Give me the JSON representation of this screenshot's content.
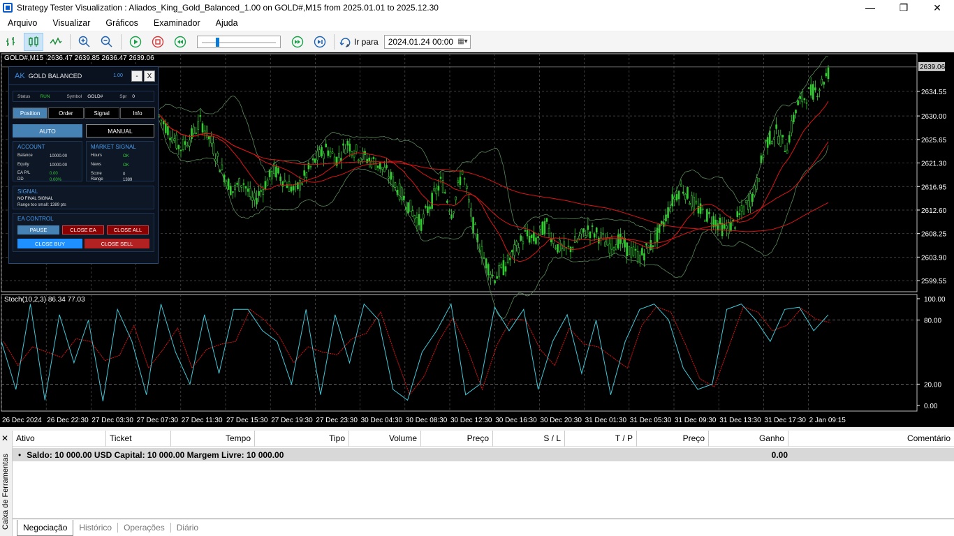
{
  "window": {
    "title": "Strategy Tester Visualization : Aliados_King_Gold_Balanced_1.00 on GOLD#,M15 from 2025.01.01 to 2025.12.30",
    "minimize": "—",
    "maximize": "❐",
    "close": "✕"
  },
  "menu": [
    "Arquivo",
    "Visualizar",
    "Gráficos",
    "Examinador",
    "Ajuda"
  ],
  "toolbar": {
    "goto_label": "Ir para",
    "goto_date": "2024.01.24 00:00",
    "slider_position": 0.19
  },
  "chart": {
    "symbol_label": "GOLD#,M15",
    "ohlc": "2636.47 2639.85 2636.47 2639.06",
    "current_price_label": "2639.06",
    "price_ticks": [
      "2634.55",
      "2630.00",
      "2625.65",
      "2621.30",
      "2616.95",
      "2612.60",
      "2608.25",
      "2603.90",
      "2599.55"
    ],
    "stoch_label": "Stoch(10,2,3) 86.34 77.03",
    "stoch_ticks": [
      "100.00",
      "80.00",
      "20.00",
      "0.00"
    ],
    "time_ticks": [
      "26 Dec 2024",
      "26 Dec 22:30",
      "27 Dec 03:30",
      "27 Dec 07:30",
      "27 Dec 11:30",
      "27 Dec 15:30",
      "27 Dec 19:30",
      "27 Dec 23:30",
      "30 Dec 04:30",
      "30 Dec 08:30",
      "30 Dec 12:30",
      "30 Dec 16:30",
      "30 Dec 20:30",
      "31 Dec 01:30",
      "31 Dec 05:30",
      "31 Dec 09:30",
      "31 Dec 13:30",
      "31 Dec 17:30",
      "2 Jan 09:15"
    ],
    "colors": {
      "background": "#000000",
      "candles": "#32cd32",
      "ma": "#dc1414",
      "bands": "#5a8a5a",
      "stoch_main": "#40c8d8",
      "stoch_signal": "#dc1414"
    }
  },
  "chart_data": {
    "type": "candlestick",
    "price_path": [
      2630,
      2627,
      2624,
      2626,
      2629,
      2625,
      2620,
      2616,
      2618,
      2614,
      2617,
      2620,
      2618,
      2616,
      2619,
      2622,
      2624,
      2622,
      2625,
      2623,
      2622,
      2621,
      2619,
      2616,
      2613,
      2610,
      2614,
      2618,
      2612,
      2620,
      2610,
      2604,
      2600,
      2602,
      2605,
      2608,
      2607,
      2610,
      2606,
      2605,
      2607,
      2609,
      2608,
      2606,
      2607,
      2605,
      2604,
      2606,
      2609,
      2614,
      2617,
      2614,
      2612,
      2611,
      2609,
      2610,
      2613,
      2616,
      2625,
      2627,
      2624,
      2632,
      2634,
      2635,
      2638
    ],
    "stoch_k": [
      60,
      15,
      95,
      5,
      85,
      40,
      80,
      4,
      90,
      60,
      10,
      95,
      50,
      20,
      85,
      30,
      90,
      90,
      70,
      60,
      20,
      90,
      10,
      85,
      40,
      95,
      80,
      15,
      5,
      50,
      70,
      95,
      10,
      20,
      92,
      70,
      90,
      15,
      60,
      85,
      30,
      80,
      10,
      60,
      90,
      95,
      80,
      35,
      15,
      20,
      90,
      95,
      80,
      60,
      90,
      92,
      70,
      85
    ]
  },
  "ea_panel": {
    "logo": "AK",
    "name": "GOLD BALANCED",
    "version": "1.00",
    "min_btn": "-",
    "close_btn": "X",
    "status_label": "Status",
    "status_value": "RUN",
    "symbol_label": "Symbol",
    "symbol_value": "GOLD#",
    "spread_label": "Spr",
    "spread_value": "0",
    "tabs": [
      "Position",
      "Order",
      "Signal",
      "Info"
    ],
    "auto_label": "AUTO",
    "manual_label": "MANUAL",
    "account": {
      "title": "ACCOUNT",
      "balance_label": "Balance",
      "balance": "10000.00",
      "equity_label": "Equity",
      "equity": "10000.00",
      "pl_label": "EA P/L",
      "pl": "0.00",
      "dd_label": "DD",
      "dd": "0.00%"
    },
    "market": {
      "title": "MARKET SIGNAL",
      "hours_label": "Hours",
      "hours": "OK",
      "news_label": "News",
      "news": "OK",
      "score_label": "Score",
      "score": "0",
      "range_label": "Range",
      "range": "1389"
    },
    "signal": {
      "title": "SIGNAL",
      "line1": "NO FINAL SIGNAL",
      "line2": "Range too small: 1389 pts"
    },
    "control": {
      "title": "EA CONTROL",
      "pause": "PAUSE",
      "close_ea": "CLOSE EA",
      "close_all": "CLOSE ALL",
      "close_buy": "CLOSE BUY",
      "close_sell": "CLOSE SELL"
    }
  },
  "terminal": {
    "side_label": "Caixa de Ferramentas",
    "close": "✕",
    "columns": [
      "Ativo",
      "Ticket",
      "Tempo",
      "Tipo",
      "Volume",
      "Preço",
      "S / L",
      "T / P",
      "Preço",
      "Ganho",
      "Comentário"
    ],
    "balance_text": "Saldo: 10 000.00 USD  Capital: 10 000.00  Margem Livre: 10 000.00",
    "balance_profit": "0.00",
    "tabs": [
      "Negociação",
      "Histórico",
      "Operações",
      "Diário"
    ]
  }
}
